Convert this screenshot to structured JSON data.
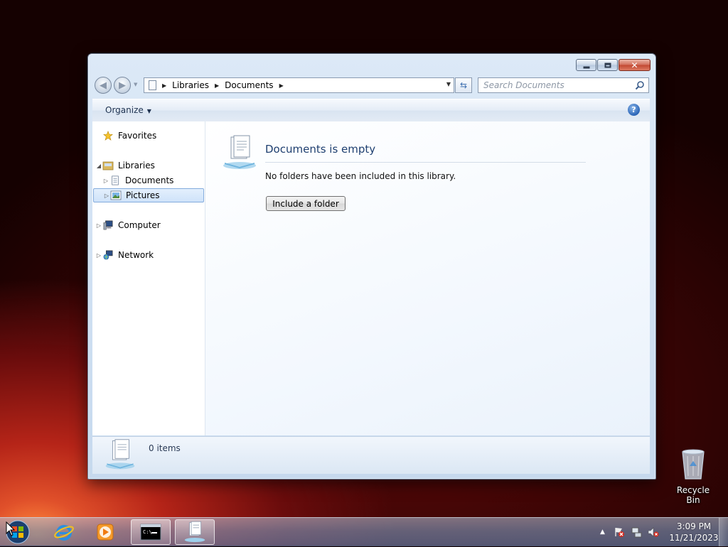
{
  "window": {
    "address": {
      "crumbs": [
        "Libraries",
        "Documents"
      ]
    },
    "search": {
      "placeholder": "Search Documents"
    },
    "toolbar": {
      "organize_label": "Organize",
      "help_label": "?"
    },
    "nav_tree": [
      {
        "label": "Favorites",
        "icon": "star-icon"
      },
      {
        "label": "Libraries",
        "icon": "libraries-icon",
        "expanded": true
      },
      {
        "label": "Documents",
        "icon": "document-icon"
      },
      {
        "label": "Pictures",
        "icon": "pictures-icon",
        "selected": true
      },
      {
        "label": "Computer",
        "icon": "computer-icon"
      },
      {
        "label": "Network",
        "icon": "network-icon"
      }
    ],
    "content": {
      "empty_title": "Documents is empty",
      "empty_desc": "No folders have been included in this library.",
      "include_button": "Include a folder"
    },
    "details": {
      "item_count": "0 items"
    }
  },
  "desktop": {
    "recycle_bin_label": "Recycle Bin"
  },
  "taskbar": {
    "pinned": [
      "internet-explorer-icon",
      "media-player-icon",
      "command-prompt-icon",
      "documents-library-icon"
    ],
    "tray_icons": [
      "show-hidden-icons",
      "action-center-icon",
      "network-icon",
      "volume-muted-icon"
    ],
    "clock": {
      "time": "3:09 PM",
      "date": "11/21/2023"
    }
  },
  "colors": {
    "window_frame": "#c6d9ee",
    "title_text": "#1e3f70",
    "selection": "#cfe3fa",
    "close_button": "#c24832"
  }
}
